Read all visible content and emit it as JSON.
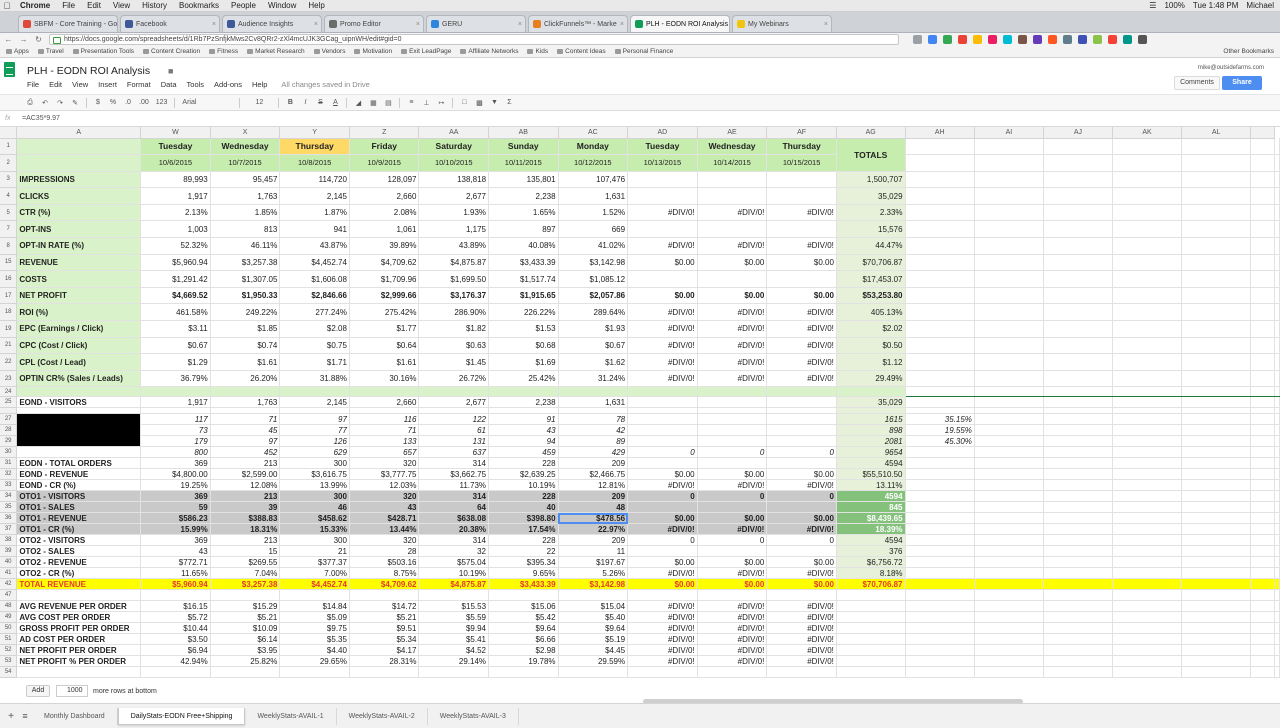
{
  "menubar": {
    "app": "Chrome",
    "items": [
      "File",
      "Edit",
      "View",
      "History",
      "Bookmarks",
      "People",
      "Window",
      "Help"
    ],
    "battery": "100%",
    "clock": "Tue 1:48 PM",
    "user": "Michael"
  },
  "tabs": [
    {
      "label": "SBFM - Core Training - Go",
      "color": "#e0483a"
    },
    {
      "label": "Facebook",
      "color": "#3b5998"
    },
    {
      "label": "Audience Insights",
      "color": "#3b5998"
    },
    {
      "label": "Promo Editor",
      "color": "#6b6b6b"
    },
    {
      "label": "GERU",
      "color": "#2e86de"
    },
    {
      "label": "ClickFunnels™ - Marke",
      "color": "#e67e22"
    },
    {
      "label": "PLH - EODN ROI Analysis",
      "color": "#0f9d58"
    },
    {
      "label": "My Webinars",
      "color": "#f1c40f"
    }
  ],
  "address": {
    "url": "https://docs.google.com/spreadsheets/d/1Rb7PzSnfjkMws2Cv8QRr2-zXl4mcUJK3GCag_uipnWH/edit#gid=0"
  },
  "bookmarks": [
    "Apps",
    "Travel",
    "Presentation Tools",
    "Content Creation",
    "Fitness",
    "Market Research",
    "Vendors",
    "Motivation",
    "Exit LeadPage",
    "Affiliate Networks",
    "Kids",
    "Content Ideas",
    "Personal Finance"
  ],
  "bookmarks_other": "Other Bookmarks",
  "doc": {
    "title": "PLH - EODN ROI Analysis",
    "menu": [
      "File",
      "Edit",
      "View",
      "Insert",
      "Format",
      "Data",
      "Tools",
      "Add-ons",
      "Help"
    ],
    "saved_status": "All changes saved in Drive",
    "user_email": "mike@outsidefarms.com",
    "comments_label": "Comments",
    "share_label": "Share"
  },
  "edittoolbar": {
    "font": "Arial",
    "size": "12",
    "zoom": "123"
  },
  "formula": {
    "fx": "fx",
    "value": "=AC35*9.97"
  },
  "grid": {
    "columns": [
      "A",
      "W",
      "X",
      "Y",
      "Z",
      "AA",
      "AB",
      "AC",
      "AD",
      "AE",
      "AF",
      "AG",
      "AH",
      "AI",
      "AJ",
      "AK",
      "AL"
    ],
    "days": [
      "Tuesday",
      "Wednesday",
      "Thursday",
      "Friday",
      "Saturday",
      "Sunday",
      "Monday",
      "Tuesday",
      "Wednesday",
      "Thursday"
    ],
    "dates": [
      "10/6/2015",
      "10/7/2015",
      "10/8/2015",
      "10/9/2015",
      "10/10/2015",
      "10/11/2015",
      "10/12/2015",
      "10/13/2015",
      "10/14/2015",
      "10/15/2015"
    ],
    "totals_label": "TOTALS",
    "metrics": [
      {
        "row": "3",
        "label": "IMPRESSIONS",
        "values": [
          "89,993",
          "95,457",
          "114,720",
          "128,097",
          "138,818",
          "135,801",
          "107,476",
          "",
          "",
          ""
        ],
        "total": "1,500,707"
      },
      {
        "row": "4",
        "label": "CLICKS",
        "values": [
          "1,917",
          "1,763",
          "2,145",
          "2,660",
          "2,677",
          "2,238",
          "1,631",
          "",
          "",
          ""
        ],
        "total": "35,029"
      },
      {
        "row": "5",
        "label": "CTR (%)",
        "values": [
          "2.13%",
          "1.85%",
          "1.87%",
          "2.08%",
          "1.93%",
          "1.65%",
          "1.52%",
          "#DIV/0!",
          "#DIV/0!",
          "#DIV/0!"
        ],
        "total": "2.33%"
      },
      {
        "row": "7",
        "label": "OPT-INS",
        "values": [
          "1,003",
          "813",
          "941",
          "1,061",
          "1,175",
          "897",
          "669",
          "",
          "",
          ""
        ],
        "total": "15,576"
      },
      {
        "row": "8",
        "label": "OPT-IN RATE (%)",
        "values": [
          "52.32%",
          "46.11%",
          "43.87%",
          "39.89%",
          "43.89%",
          "40.08%",
          "41.02%",
          "#DIV/0!",
          "#DIV/0!",
          "#DIV/0!"
        ],
        "total": "44.47%"
      },
      {
        "row": "15",
        "label": "REVENUE",
        "values": [
          "$5,960.94",
          "$3,257.38",
          "$4,452.74",
          "$4,709.62",
          "$4,875.87",
          "$3,433.39",
          "$3,142.98",
          "$0.00",
          "$0.00",
          "$0.00"
        ],
        "total": "$70,706.87"
      },
      {
        "row": "16",
        "label": "COSTS",
        "values": [
          "$1,291.42",
          "$1,307.05",
          "$1,606.08",
          "$1,709.96",
          "$1,699.50",
          "$1,517.74",
          "$1,085.12",
          "",
          "",
          ""
        ],
        "total": "$17,453.07"
      },
      {
        "row": "17",
        "label": "NET PROFIT",
        "values": [
          "$4,669.52",
          "$1,950.33",
          "$2,846.66",
          "$2,999.66",
          "$3,176.37",
          "$1,915.65",
          "$2,057.86",
          "$0.00",
          "$0.00",
          "$0.00"
        ],
        "total": "$53,253.80",
        "bold": true
      },
      {
        "row": "18",
        "label": "ROI (%)",
        "values": [
          "461.58%",
          "249.22%",
          "277.24%",
          "275.42%",
          "286.90%",
          "226.22%",
          "289.64%",
          "#DIV/0!",
          "#DIV/0!",
          "#DIV/0!"
        ],
        "total": "405.13%"
      },
      {
        "row": "19",
        "label": "EPC (Earnings / Click)",
        "values": [
          "$3.11",
          "$1.85",
          "$2.08",
          "$1.77",
          "$1.82",
          "$1.53",
          "$1.93",
          "#DIV/0!",
          "#DIV/0!",
          "#DIV/0!"
        ],
        "total": "$2.02"
      },
      {
        "row": "21",
        "label": "CPC (Cost / Click)",
        "values": [
          "$0.67",
          "$0.74",
          "$0.75",
          "$0.64",
          "$0.63",
          "$0.68",
          "$0.67",
          "#DIV/0!",
          "#DIV/0!",
          "#DIV/0!"
        ],
        "total": "$0.50"
      },
      {
        "row": "22",
        "label": "CPL (Cost / Lead)",
        "values": [
          "$1.29",
          "$1.61",
          "$1.71",
          "$1.61",
          "$1.45",
          "$1.69",
          "$1.62",
          "#DIV/0!",
          "#DIV/0!",
          "#DIV/0!"
        ],
        "total": "$1.12"
      },
      {
        "row": "23",
        "label": "OPTIN CR% (Sales / Leads)",
        "values": [
          "36.79%",
          "26.20%",
          "31.88%",
          "30.16%",
          "26.72%",
          "25.42%",
          "31.24%",
          "#DIV/0!",
          "#DIV/0!",
          "#DIV/0!"
        ],
        "total": "29.49%"
      }
    ],
    "eond_visitors": {
      "row": "25",
      "label": "EOND - VISITORS",
      "values": [
        "1,917",
        "1,763",
        "2,145",
        "2,660",
        "2,677",
        "2,238",
        "1,631",
        "",
        "",
        ""
      ],
      "total": "35,029"
    },
    "hidden_rows": [
      {
        "row": "27",
        "values": [
          "117",
          "71",
          "97",
          "116",
          "122",
          "91",
          "78",
          "",
          "",
          ""
        ],
        "total": "1615",
        "extra": "35.15%"
      },
      {
        "row": "28",
        "values": [
          "73",
          "45",
          "77",
          "71",
          "61",
          "43",
          "42",
          "",
          "",
          ""
        ],
        "total": "898",
        "extra": "19.55%"
      },
      {
        "row": "29",
        "values": [
          "179",
          "97",
          "126",
          "133",
          "131",
          "94",
          "89",
          "",
          "",
          ""
        ],
        "total": "2081",
        "extra": "45.30%"
      },
      {
        "row": "30",
        "values": [
          "800",
          "452",
          "629",
          "657",
          "637",
          "459",
          "429",
          "0",
          "0",
          "0"
        ],
        "total": "9654",
        "extra": ""
      }
    ],
    "orders": [
      {
        "row": "31",
        "label": "EODN - TOTAL ORDERS",
        "values": [
          "369",
          "213",
          "300",
          "320",
          "314",
          "228",
          "209",
          "",
          "",
          ""
        ],
        "total": "4594",
        "style": "plain"
      },
      {
        "row": "32",
        "label": "EOND - REVENUE",
        "values": [
          "$4,800.00",
          "$2,599.00",
          "$3,616.75",
          "$3,777.75",
          "$3,662.75",
          "$2,639.25",
          "$2,466.75",
          "$0.00",
          "$0.00",
          "$0.00"
        ],
        "total": "$55,510.50",
        "style": "plain"
      },
      {
        "row": "33",
        "label": "EOND - CR (%)",
        "values": [
          "19.25%",
          "12.08%",
          "13.99%",
          "12.03%",
          "11.73%",
          "10.19%",
          "12.81%",
          "#DIV/0!",
          "#DIV/0!",
          "#DIV/0!"
        ],
        "total": "13.11%",
        "style": "plain"
      },
      {
        "row": "34",
        "label": "OTO1 - VISITORS",
        "values": [
          "369",
          "213",
          "300",
          "320",
          "314",
          "228",
          "209",
          "0",
          "0",
          "0"
        ],
        "total": "4594",
        "style": "gray"
      },
      {
        "row": "35",
        "label": "OTO1 - SALES",
        "values": [
          "59",
          "39",
          "46",
          "43",
          "64",
          "40",
          "48",
          "",
          "",
          ""
        ],
        "total": "845",
        "style": "gray"
      },
      {
        "row": "36",
        "label": "OTO1 - REVENUE",
        "values": [
          "$586.23",
          "$388.83",
          "$458.62",
          "$428.71",
          "$638.08",
          "$398.80",
          "$478.56",
          "$0.00",
          "$0.00",
          "$0.00"
        ],
        "total": "$8,439.65",
        "style": "gray"
      },
      {
        "row": "37",
        "label": "OTO1 - CR (%)",
        "values": [
          "15.99%",
          "18.31%",
          "15.33%",
          "13.44%",
          "20.38%",
          "17.54%",
          "22.97%",
          "#DIV/0!",
          "#DIV/0!",
          "#DIV/0!"
        ],
        "total": "18.39%",
        "style": "gray"
      },
      {
        "row": "38",
        "label": "OTO2 - VISITORS",
        "values": [
          "369",
          "213",
          "300",
          "320",
          "314",
          "228",
          "209",
          "0",
          "0",
          "0"
        ],
        "total": "4594",
        "style": "plain"
      },
      {
        "row": "39",
        "label": "OTO2 - SALES",
        "values": [
          "43",
          "15",
          "21",
          "28",
          "32",
          "22",
          "11",
          "",
          "",
          ""
        ],
        "total": "376",
        "style": "plain"
      },
      {
        "row": "40",
        "label": "OTO2 - REVENUE",
        "values": [
          "$772.71",
          "$269.55",
          "$377.37",
          "$503.16",
          "$575.04",
          "$395.34",
          "$197.67",
          "$0.00",
          "$0.00",
          "$0.00"
        ],
        "total": "$6,756.72",
        "style": "plain"
      },
      {
        "row": "41",
        "label": "OTO2 - CR (%)",
        "values": [
          "11.65%",
          "7.04%",
          "7.00%",
          "8.75%",
          "10.19%",
          "9.65%",
          "5.26%",
          "#DIV/0!",
          "#DIV/0!",
          "#DIV/0!"
        ],
        "total": "8.18%",
        "style": "plain"
      },
      {
        "row": "42",
        "label": "TOTAL REVENUE",
        "values": [
          "$5,960.94",
          "$3,257.38",
          "$4,452.74",
          "$4,709.62",
          "$4,875.87",
          "$3,433.39",
          "$3,142.98",
          "$0.00",
          "$0.00",
          "$0.00"
        ],
        "total": "$70,706.87",
        "style": "yellow"
      }
    ],
    "averages": [
      {
        "row": "48",
        "label": "AVG REVENUE PER ORDER",
        "values": [
          "$16.15",
          "$15.29",
          "$14.84",
          "$14.72",
          "$15.53",
          "$15.06",
          "$15.04",
          "#DIV/0!",
          "#DIV/0!",
          "#DIV/0!"
        ],
        "total": ""
      },
      {
        "row": "49",
        "label": "AVG COST PER ORDER",
        "values": [
          "$5.72",
          "$5.21",
          "$5.09",
          "$5.21",
          "$5.59",
          "$5.42",
          "$5.40",
          "#DIV/0!",
          "#DIV/0!",
          "#DIV/0!"
        ],
        "total": ""
      },
      {
        "row": "50",
        "label": "GROSS PROFIT PER ORDER",
        "values": [
          "$10.44",
          "$10.09",
          "$9.75",
          "$9.51",
          "$9.94",
          "$9.64",
          "$9.64",
          "#DIV/0!",
          "#DIV/0!",
          "#DIV/0!"
        ],
        "total": ""
      },
      {
        "row": "51",
        "label": "AD COST PER ORDER",
        "values": [
          "$3.50",
          "$6.14",
          "$5.35",
          "$5.34",
          "$5.41",
          "$6.66",
          "$5.19",
          "#DIV/0!",
          "#DIV/0!",
          "#DIV/0!"
        ],
        "total": ""
      },
      {
        "row": "52",
        "label": "NET PROFIT PER ORDER",
        "values": [
          "$6.94",
          "$3.95",
          "$4.40",
          "$4.17",
          "$4.52",
          "$2.98",
          "$4.45",
          "#DIV/0!",
          "#DIV/0!",
          "#DIV/0!"
        ],
        "total": ""
      },
      {
        "row": "53",
        "label": "NET PROFIT % PER ORDER",
        "values": [
          "42.94%",
          "25.82%",
          "29.65%",
          "28.31%",
          "29.14%",
          "19.78%",
          "29.59%",
          "#DIV/0!",
          "#DIV/0!",
          "#DIV/0!"
        ],
        "total": ""
      }
    ]
  },
  "bottom": {
    "add_label": "Add",
    "rows_value": "1000",
    "rows_text": "more rows at bottom",
    "sheets": [
      "Monthly Dashboard",
      "DailyStats-EODN Free+Shipping",
      "WeeklyStats-AVAIL-1",
      "WeeklyStats-AVAIL-2",
      "WeeklyStats-AVAIL-3"
    ],
    "active_sheet": 1
  }
}
